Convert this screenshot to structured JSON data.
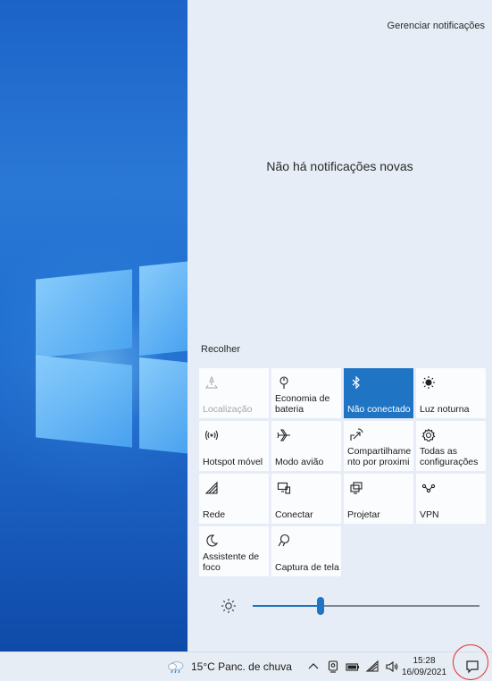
{
  "action_center": {
    "manage_notifications": "Gerenciar notificações",
    "no_notifications": "Não há notificações novas",
    "collapse": "Recolher"
  },
  "quick_actions": [
    {
      "label": "Localização",
      "icon": "location-icon",
      "state": "disabled"
    },
    {
      "label": "Economia de bateria",
      "icon": "battery-saver-icon",
      "state": "off"
    },
    {
      "label": "Não conectado",
      "icon": "bluetooth-icon",
      "state": "on"
    },
    {
      "label": "Luz noturna",
      "icon": "night-light-icon",
      "state": "off"
    },
    {
      "label": "Hotspot móvel",
      "icon": "mobile-hotspot-icon",
      "state": "off"
    },
    {
      "label": "Modo avião",
      "icon": "airplane-icon",
      "state": "off"
    },
    {
      "label": "Compartilhamento por proximidade",
      "display": "Compartilhame nto por proximi",
      "icon": "nearby-sharing-icon",
      "state": "off"
    },
    {
      "label": "Todas as configurações",
      "icon": "settings-icon",
      "state": "off"
    },
    {
      "label": "Rede",
      "icon": "network-icon",
      "state": "off"
    },
    {
      "label": "Conectar",
      "icon": "connect-icon",
      "state": "off"
    },
    {
      "label": "Projetar",
      "icon": "project-icon",
      "state": "off"
    },
    {
      "label": "VPN",
      "icon": "vpn-icon",
      "state": "off"
    },
    {
      "label": "Assistente de foco",
      "icon": "focus-assist-icon",
      "state": "off"
    },
    {
      "label": "Captura de tela",
      "icon": "snip-icon",
      "state": "off"
    }
  ],
  "brightness": {
    "value": 0.3,
    "icon": "brightness-icon"
  },
  "taskbar": {
    "weather": "15°C Panc. de chuva",
    "time": "15:28",
    "date": "16/09/2021",
    "tray_icons": [
      "chevron-up-icon",
      "webcam-icon",
      "battery-icon",
      "wifi-icon",
      "volume-icon"
    ]
  },
  "colors": {
    "accent": "#1f74c4",
    "panel": "#e6edf6",
    "tile": "#fbfcfe",
    "highlight_ring": "#e0312a"
  }
}
